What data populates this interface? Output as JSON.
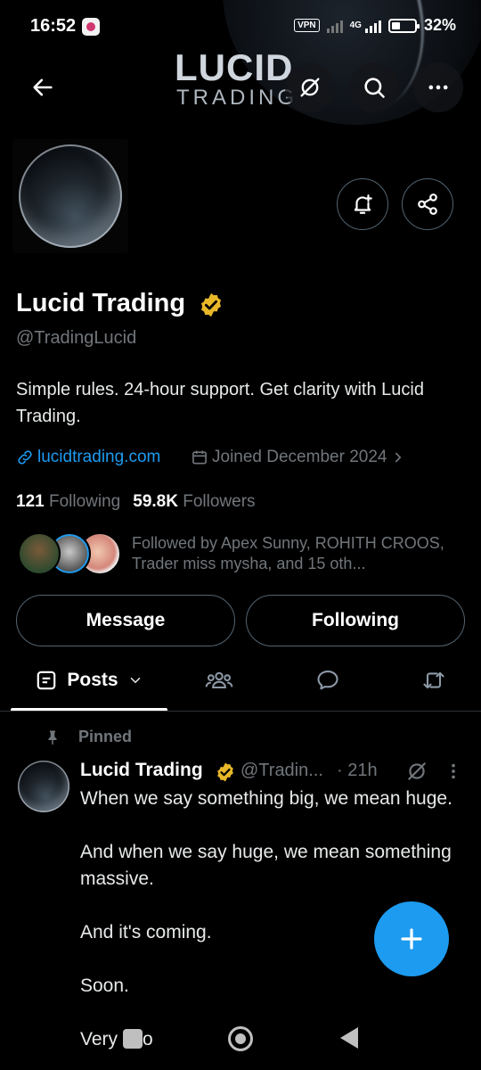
{
  "status_bar": {
    "time": "16:52",
    "vpn": "VPN",
    "network": "4G",
    "battery": "32%"
  },
  "banner": {
    "logo_line1": "LUCID",
    "logo_line2": "TRADING"
  },
  "profile": {
    "display_name": "Lucid Trading",
    "handle": "@TradingLucid",
    "bio": "Simple rules. 24-hour support. Get clarity with Lucid Trading.",
    "website": "lucidtrading.com",
    "joined": "Joined December 2024",
    "following_count": "121",
    "following_label": "Following",
    "followers_count": "59.8K",
    "followers_label": "Followers",
    "followed_by": "Followed by Apex Sunny, ROHITH CROOS, Trader miss mysha, and 15 oth..."
  },
  "actions": {
    "message": "Message",
    "following": "Following"
  },
  "tabs": {
    "posts": "Posts"
  },
  "post": {
    "pinned_label": "Pinned",
    "name": "Lucid Trading",
    "handle": "@Tradin...",
    "time": "· 21h",
    "paragraphs": [
      "When we say something big, we mean huge.",
      "And when we say huge, we mean something massive.",
      "And it's coming.",
      "Soon.",
      "Very soo"
    ]
  },
  "colors": {
    "accent": "#1d9bf0",
    "verified_gold": "#e8b829",
    "muted": "#71767b",
    "background": "#000000"
  }
}
